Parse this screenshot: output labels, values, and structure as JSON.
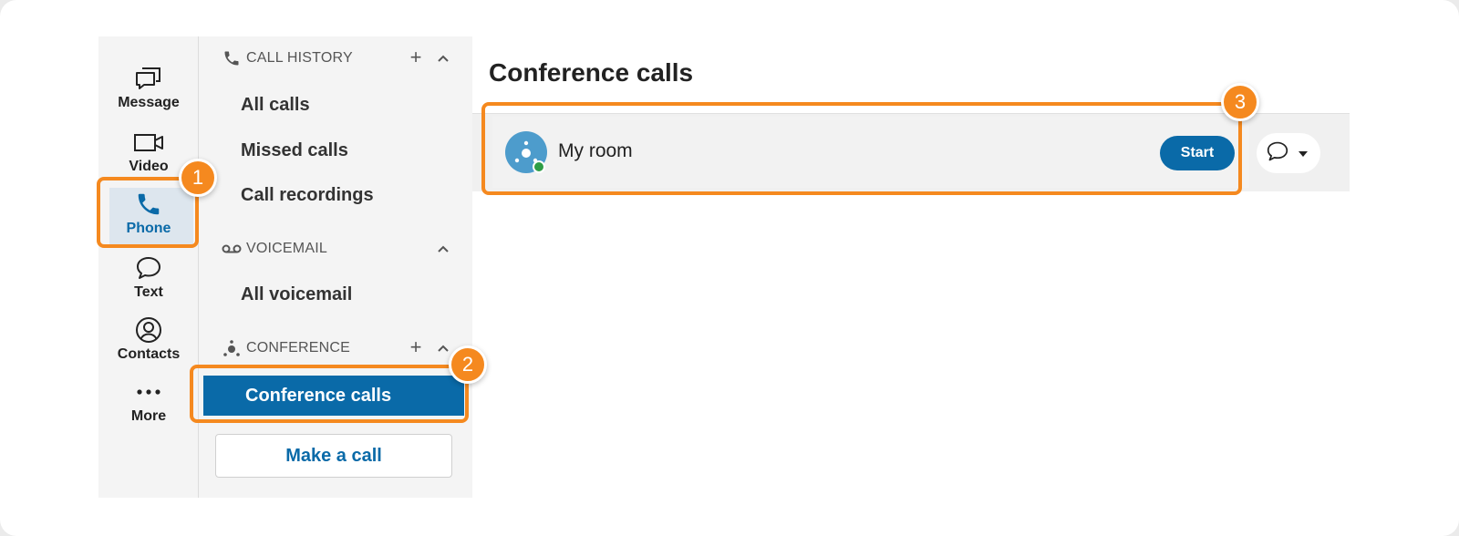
{
  "rail": {
    "items": [
      {
        "label": "Message",
        "icon": "message-icon"
      },
      {
        "label": "Video",
        "icon": "video-icon"
      },
      {
        "label": "Phone",
        "icon": "phone-icon",
        "active": true
      },
      {
        "label": "Text",
        "icon": "chat-bubble-icon"
      },
      {
        "label": "Contacts",
        "icon": "contacts-icon"
      },
      {
        "label": "More",
        "icon": "more-icon"
      }
    ]
  },
  "nav": {
    "call_history": {
      "title": "CALL HISTORY",
      "items": [
        "All calls",
        "Missed calls",
        "Call recordings"
      ]
    },
    "voicemail": {
      "title": "VOICEMAIL",
      "items": [
        "All voicemail"
      ]
    },
    "conference": {
      "title": "CONFERENCE",
      "selected": "Conference calls"
    },
    "make_call": "Make a call"
  },
  "main": {
    "title": "Conference calls",
    "room": {
      "name": "My room",
      "start_label": "Start",
      "presence": "online"
    }
  },
  "callouts": [
    "1",
    "2",
    "3"
  ],
  "colors": {
    "accent": "#0a6aa8",
    "highlight": "#f5891f",
    "presence": "#2e9d46"
  }
}
